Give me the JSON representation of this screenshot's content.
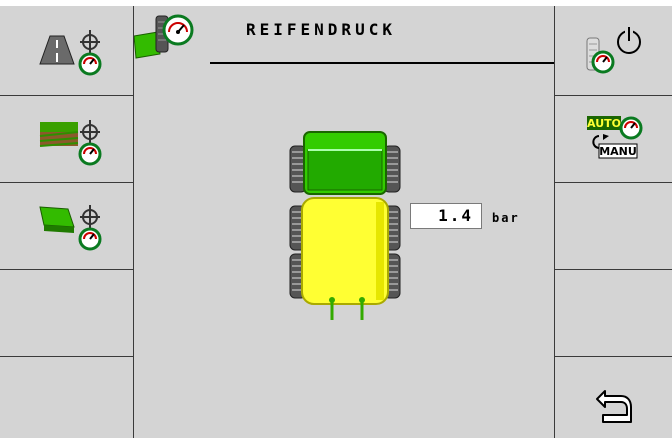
{
  "screen": {
    "title": "REIFENDRUCK",
    "pressure": {
      "value": "1.4",
      "unit": "bar"
    }
  },
  "softkeys_left": [
    {
      "name": "road-mode-tire-pressure",
      "icon": "road-tire-gauge-icon"
    },
    {
      "name": "field-mode-tire-pressure",
      "icon": "field-tire-gauge-icon"
    },
    {
      "name": "custom-mode-tire-pressure",
      "icon": "green-flag-tire-gauge-icon"
    },
    {
      "name": "empty-left-4"
    },
    {
      "name": "empty-left-5"
    }
  ],
  "softkeys_right": [
    {
      "name": "tire-pressure-on-off",
      "icon": "tire-gauge-power-icon"
    },
    {
      "name": "auto-manu-toggle",
      "icon": "auto-manu-icon",
      "label_top": "AUTO",
      "label_bottom": "MANU"
    },
    {
      "name": "empty-right-3"
    },
    {
      "name": "empty-right-4"
    },
    {
      "name": "back",
      "icon": "back-arrow-icon"
    }
  ],
  "colors": {
    "background": "#d4d4d4",
    "tractor_cab": "#33cc00",
    "implement": "#ffff33",
    "tire": "#555555"
  }
}
